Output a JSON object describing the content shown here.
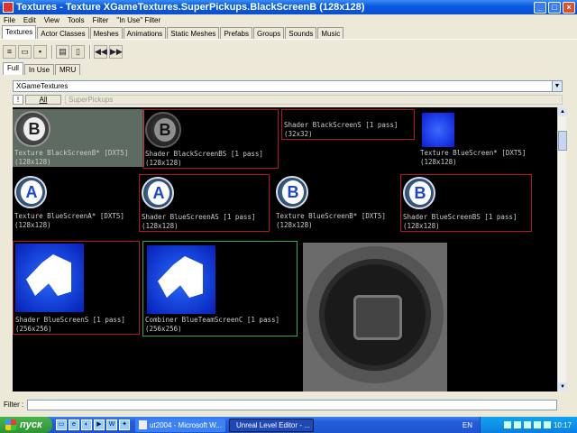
{
  "window": {
    "title": "Textures - Texture XGameTextures.SuperPickups.BlackScreenB (128x128)"
  },
  "menu": [
    "File",
    "Edit",
    "View",
    "Tools",
    "Filter",
    "\"In Use\" Filter"
  ],
  "tabs": [
    "Textures",
    "Actor Classes",
    "Meshes",
    "Animations",
    "Static Meshes",
    "Prefabs",
    "Groups",
    "Sounds",
    "Music"
  ],
  "active_tab": "Textures",
  "subtabs": [
    "Full",
    "In Use",
    "MRU"
  ],
  "package_combo": "XGameTextures",
  "group_filter": {
    "all_label": "All",
    "package": "SuperPickups"
  },
  "textures": [
    {
      "label": "Texture BlackScreenB* [DXT5]",
      "size": "(128x128)"
    },
    {
      "label": "Shader BlackScreenBS [1 pass]",
      "size": "(128x128)"
    },
    {
      "label": "Shader BlackScreenS [1 pass]",
      "size": "(32x32)"
    },
    {
      "label": "Texture BlueScreen* [DXT5]",
      "size": "(128x128)"
    },
    {
      "label": "Texture BlueScreenA* [DXT5]",
      "size": "(128x128)"
    },
    {
      "label": "Shader BlueScreenAS [1 pass]",
      "size": "(128x128)"
    },
    {
      "label": "Texture BlueScreenB* [DXT5]",
      "size": "(128x128)"
    },
    {
      "label": "Shader BlueScreenBS [1 pass]",
      "size": "(128x128)"
    },
    {
      "label": "Shader BlueScreenS [1 pass]",
      "size": "(256x256)"
    },
    {
      "label": "Combiner BlueTeamScreenC [1 pass]",
      "size": "(256x256)"
    }
  ],
  "filter_label": "Filter :",
  "taskbar": {
    "start": "пуск",
    "tasks": [
      "ut2004 - Microsoft W...",
      "Unreal Level Editor - ..."
    ],
    "lang": "EN",
    "clock": "10:17"
  }
}
